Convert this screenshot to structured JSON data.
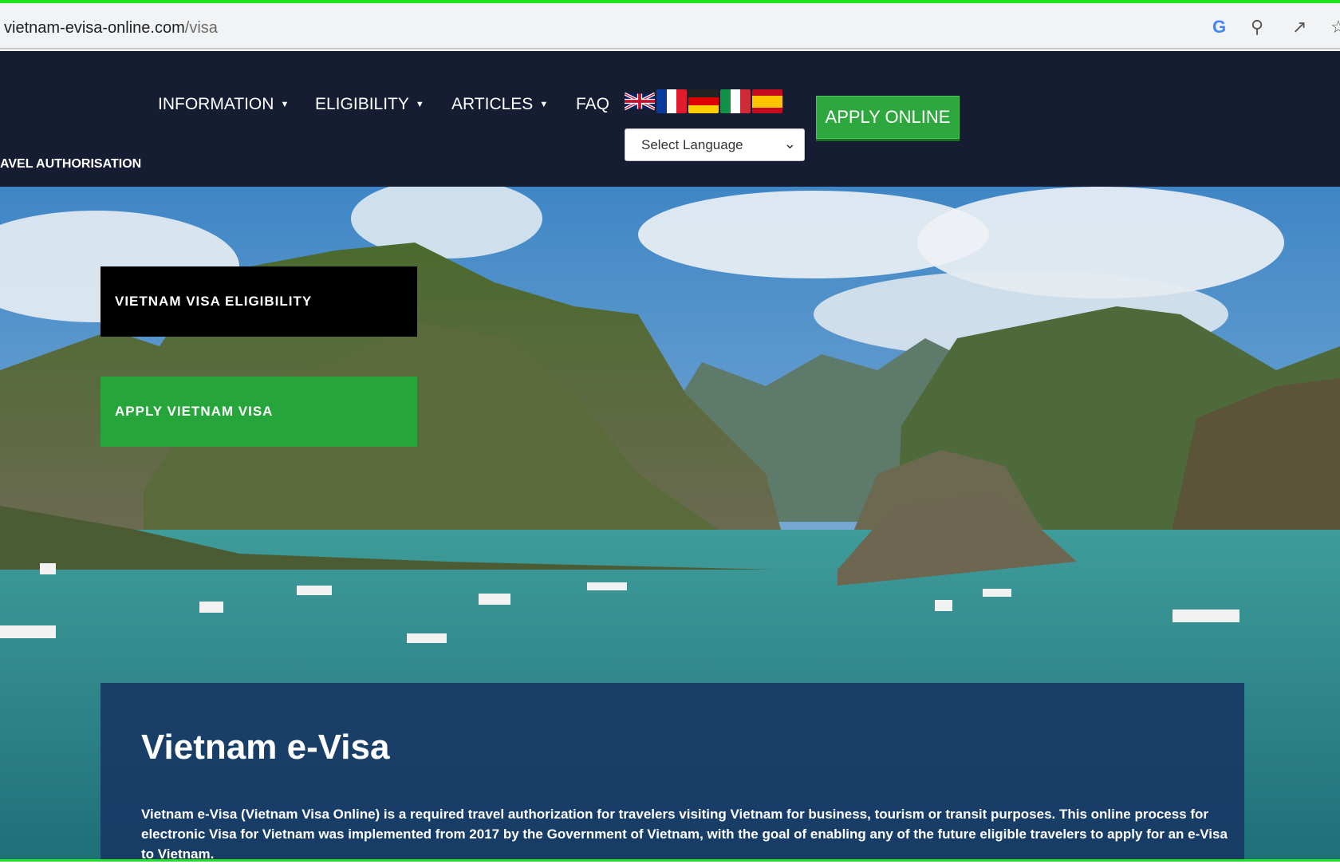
{
  "browser": {
    "url_host": "vietnam-evisa-online.com",
    "url_path": "/visa",
    "icons": [
      "google-icon",
      "zoom-icon",
      "share-icon",
      "star-icon"
    ]
  },
  "nav": {
    "items": [
      {
        "label": "INFORMATION",
        "has_dropdown": true
      },
      {
        "label": "ELIGIBILITY",
        "has_dropdown": true
      },
      {
        "label": "ARTICLES",
        "has_dropdown": true
      },
      {
        "label": "FAQ",
        "has_dropdown": false
      }
    ],
    "flags": [
      "english",
      "french",
      "german",
      "italian",
      "spanish"
    ],
    "language_select": "Select Language",
    "apply_label": "APPLY ONLINE",
    "tagline": "AVEL AUTHORISATION"
  },
  "hero": {
    "eligibility_label": "VIETNAM VISA ELIGIBILITY",
    "apply_label": "APPLY VIETNAM VISA"
  },
  "panel": {
    "title": "Vietnam e-Visa",
    "text": "Vietnam e-Visa (Vietnam Visa Online) is a required travel authorization for travelers visiting Vietnam for business, tourism or transit purposes. This online process for electronic Visa for Vietnam was implemented from 2017 by the Government of Vietnam, with the goal of enabling any of the future eligible travelers to apply for an e-Visa to Vietnam."
  },
  "colors": {
    "nav_bg": "#161d33",
    "apply_green": "#2ea83e",
    "panel_blue": "#163464"
  }
}
